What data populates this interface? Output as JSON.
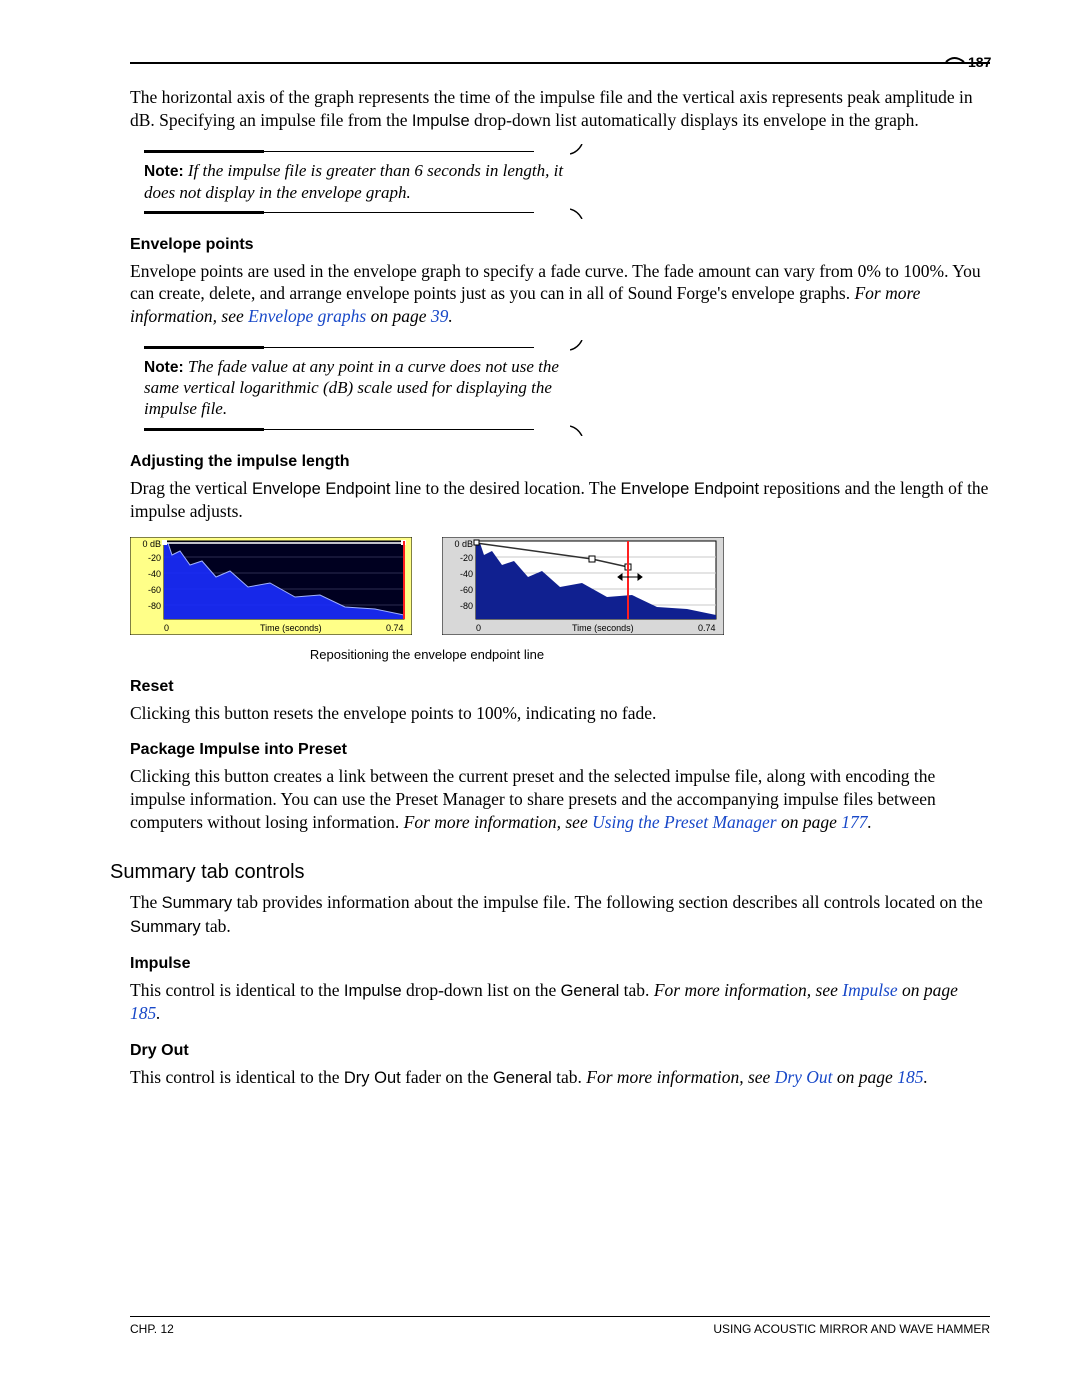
{
  "page_number": "187",
  "intro_para": "The horizontal axis of the graph represents the time of the impulse file and the vertical axis represents peak amplitude in dB. Specifying an impulse file from the ",
  "intro_sans1": "Impulse",
  "intro_para2": " drop-down list automatically displays its envelope in the graph.",
  "note1_label": "Note:",
  "note1_text": " If the impulse file is greater than 6 seconds in length, it does not display in the envelope graph.",
  "h_env": "Envelope points",
  "env_text_a": "Envelope points are used in the envelope graph to specify a fade curve. The fade amount can vary from 0% to 100%. You can create, delete, and arrange envelope points just as you can in all of Sound Forge's envelope graphs. ",
  "env_text_b": "For more information, see ",
  "env_link": "Envelope graphs",
  "env_text_c": " on page ",
  "env_page": "39",
  "env_text_d": ".",
  "note2_label": "Note:",
  "note2_text": " The fade value at any point in a curve does not use the same vertical logarithmic (dB) scale used for displaying the impulse file.",
  "h_adj": "Adjusting the impulse length",
  "adj_a": "Drag the vertical ",
  "adj_sans1": "Envelope Endpoint",
  "adj_b": " line to the desired location. The ",
  "adj_sans2": "Envelope Endpoint",
  "adj_c": " repositions and the length of the impulse adjusts.",
  "fig_caption": "Repositioning the envelope endpoint line",
  "h_reset": "Reset",
  "reset_text": "Clicking this button resets the envelope points to 100%, indicating no fade.",
  "h_pkg": "Package Impulse into Preset",
  "pkg_a": "Clicking this button creates a link between the current preset and the selected impulse file, along with encoding the impulse information. You can use the Preset Manager to share presets and the accompanying impulse files between computers without losing information. ",
  "pkg_b": "For more information, see ",
  "pkg_link": "Using the Preset Manager",
  "pkg_c": " on page ",
  "pkg_page": "177",
  "pkg_d": ".",
  "h_summary": "Summary tab controls",
  "sum_a": "The ",
  "sum_sans1": "Summary",
  "sum_b": " tab provides information about the impulse file. The following section describes all controls located on the ",
  "sum_sans2": "Summary",
  "sum_c": " tab.",
  "h_impulse": "Impulse",
  "imp_a": "This control is identical to the ",
  "imp_sans1": "Impulse",
  "imp_b": " drop-down list on the ",
  "imp_sans2": "General",
  "imp_c": " tab. ",
  "imp_d": "For more information, see ",
  "imp_link": "Impulse",
  "imp_e": " on page ",
  "imp_page": "185",
  "imp_f": ".",
  "h_dry": "Dry Out",
  "dry_a": "This control is identical to the ",
  "dry_sans1": "Dry Out",
  "dry_b": " fader on the ",
  "dry_sans2": "General",
  "dry_c": " tab. ",
  "dry_d": "For more information, see ",
  "dry_link": "Dry Out",
  "dry_e": " on page ",
  "dry_page": "185",
  "dry_f": ".",
  "footer_left": "CHP. 12",
  "footer_right": "USING ACOUSTIC MIRROR AND WAVE HAMMER",
  "chart_data": [
    {
      "type": "area",
      "title": "",
      "xlabel": "Time (seconds)",
      "ylabel": "dB",
      "xlim": [
        0,
        0.74
      ],
      "ylim": [
        -80,
        0
      ],
      "y_ticks": [
        "0 dB",
        "-20",
        "-40",
        "-60",
        "-80"
      ],
      "x_ticks": [
        "0",
        "0.74"
      ],
      "envelope_line": [
        [
          0,
          0
        ],
        [
          0.74,
          0
        ]
      ],
      "endpoint_x": 0.74,
      "bg": "#000020",
      "frame": "#ffff80"
    },
    {
      "type": "area",
      "title": "",
      "xlabel": "Time (seconds)",
      "ylabel": "dB",
      "xlim": [
        0,
        0.74
      ],
      "ylim": [
        -80,
        0
      ],
      "y_ticks": [
        "0 dB",
        "-20",
        "-40",
        "-60",
        "-80"
      ],
      "x_ticks": [
        "0",
        "0.74"
      ],
      "envelope_line": [
        [
          0,
          0
        ],
        [
          0.36,
          -16
        ],
        [
          0.47,
          -23
        ]
      ],
      "endpoint_x": 0.47,
      "bg": "#ffffff",
      "frame": "#404040"
    }
  ]
}
